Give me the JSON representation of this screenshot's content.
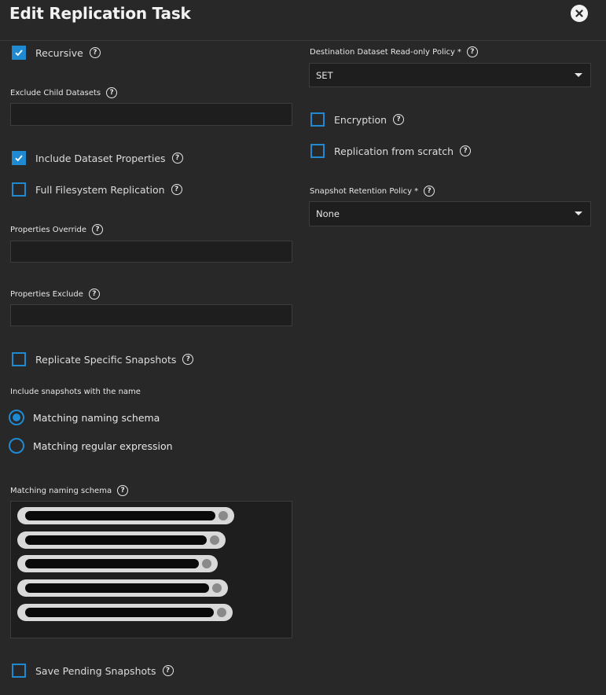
{
  "dialog": {
    "title": "Edit Replication Task"
  },
  "left": {
    "recursive": {
      "label": "Recursive",
      "checked": true
    },
    "exclude_child_datasets": {
      "label": "Exclude Child Datasets",
      "value": ""
    },
    "include_dataset_properties": {
      "label": "Include Dataset Properties",
      "checked": true
    },
    "full_filesystem_replication": {
      "label": "Full Filesystem Replication",
      "checked": false
    },
    "properties_override": {
      "label": "Properties Override",
      "value": ""
    },
    "properties_exclude": {
      "label": "Properties Exclude",
      "value": ""
    },
    "replicate_specific_snapshots": {
      "label": "Replicate Specific Snapshots",
      "checked": false
    },
    "include_snapshots": {
      "label": "Include snapshots with the name",
      "options": [
        {
          "label": "Matching naming schema",
          "selected": true
        },
        {
          "label": "Matching regular expression",
          "selected": false
        }
      ]
    },
    "matching_naming_schema": {
      "label": "Matching naming schema",
      "chips": [
        "",
        "",
        "",
        "",
        ""
      ]
    },
    "save_pending_snapshots": {
      "label": "Save Pending Snapshots",
      "checked": false
    }
  },
  "right": {
    "destination_readonly": {
      "label": "Destination Dataset Read-only Policy",
      "required_mark": "*",
      "value": "SET"
    },
    "encryption": {
      "label": "Encryption",
      "checked": false
    },
    "replication_from_scratch": {
      "label": "Replication from scratch",
      "checked": false
    },
    "snapshot_retention": {
      "label": "Snapshot Retention Policy",
      "required_mark": "*",
      "value": "None"
    }
  },
  "icons": {
    "help": "help-circle-icon",
    "close": "close-icon",
    "check": "check-icon"
  },
  "colors": {
    "accent": "#1f8ad2",
    "background": "#282828",
    "input_bg": "#1e1e1e"
  }
}
